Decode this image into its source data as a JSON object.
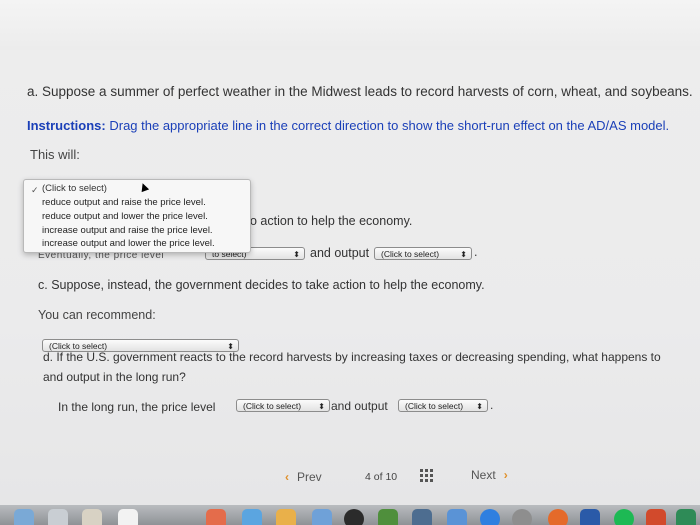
{
  "question_a": "a. Suppose a summer of perfect weather in the Midwest leads to record harvests of corn, wheat, and soybeans.",
  "instructions": {
    "label": "Instructions:",
    "text": " Drag the appropriate line in the correct direction to show the short-run effect on the AD/AS model."
  },
  "this_will": "This will:",
  "dropdown": {
    "options": [
      "(Click to select)",
      "reduce output and raise the price level.",
      "reduce output and lower the price level.",
      "increase output and raise the price level.",
      "increase output and lower the price level."
    ],
    "checked": "✓"
  },
  "partial_b": "o action to help the economy.",
  "partial_eventually": "Eventually, the price level",
  "select_price_partial": "to select)",
  "and_output": "and output",
  "select_output_1": "(Click to select)",
  "question_c": "c. Suppose, instead, the government decides to take action to help the economy.",
  "you_can_recommend": "You can recommend:",
  "select_recommend": "(Click to select)",
  "question_d_line1": "d. If the U.S. government reacts to the record harvests by increasing taxes or decreasing spending, what happens to",
  "question_d_line2": "and output in the long run?",
  "long_run_text": "In the long run, the price level",
  "select_longrun_price": "(Click to select)",
  "and_output_2": "and output",
  "select_longrun_output": "(Click to select)",
  "period": ".",
  "pager": {
    "prev": "Prev",
    "current": "4",
    "of": "of",
    "total": "10",
    "next": "Next"
  },
  "colors": {
    "instructions": "#1a3fb8",
    "pager_chevron": "#e0902a"
  },
  "icons": {
    "up_down_arrow": "⬍",
    "chev_left": "‹",
    "chev_right": "›"
  }
}
